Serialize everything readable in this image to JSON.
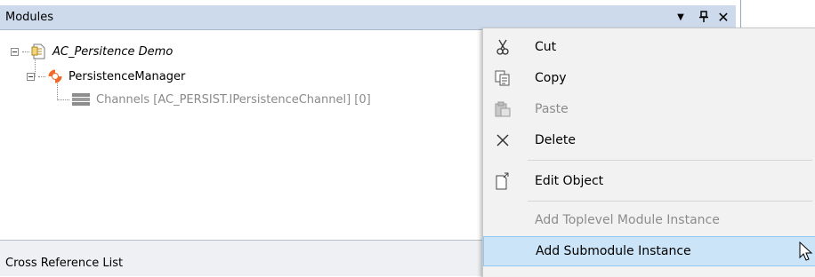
{
  "modules": {
    "title": "Modules",
    "tree": {
      "root_label": "AC_Persitence Demo",
      "manager_label": "PersistenceManager",
      "channels_label": "Channels [AC_PERSIST.IPersistenceChannel] [0]"
    }
  },
  "cross_reference": {
    "title": "Cross Reference List"
  },
  "context_menu": {
    "items": [
      {
        "label": "Cut",
        "icon": "scissors-icon",
        "enabled": true
      },
      {
        "label": "Copy",
        "icon": "copy-icon",
        "enabled": true
      },
      {
        "label": "Paste",
        "icon": "paste-icon",
        "enabled": false
      },
      {
        "label": "Delete",
        "icon": "delete-x-icon",
        "enabled": true
      },
      {
        "label": "Edit Object",
        "icon": "edit-object-icon",
        "enabled": true
      },
      {
        "label": "Add Toplevel Module Instance",
        "icon": "",
        "enabled": false
      },
      {
        "label": "Add Submodule Instance",
        "icon": "",
        "enabled": true,
        "highlighted": true
      }
    ]
  },
  "colors": {
    "header_bg": "#ccdaeb",
    "menu_bg": "#f2f2f2",
    "menu_highlight": "#cce4f7"
  }
}
